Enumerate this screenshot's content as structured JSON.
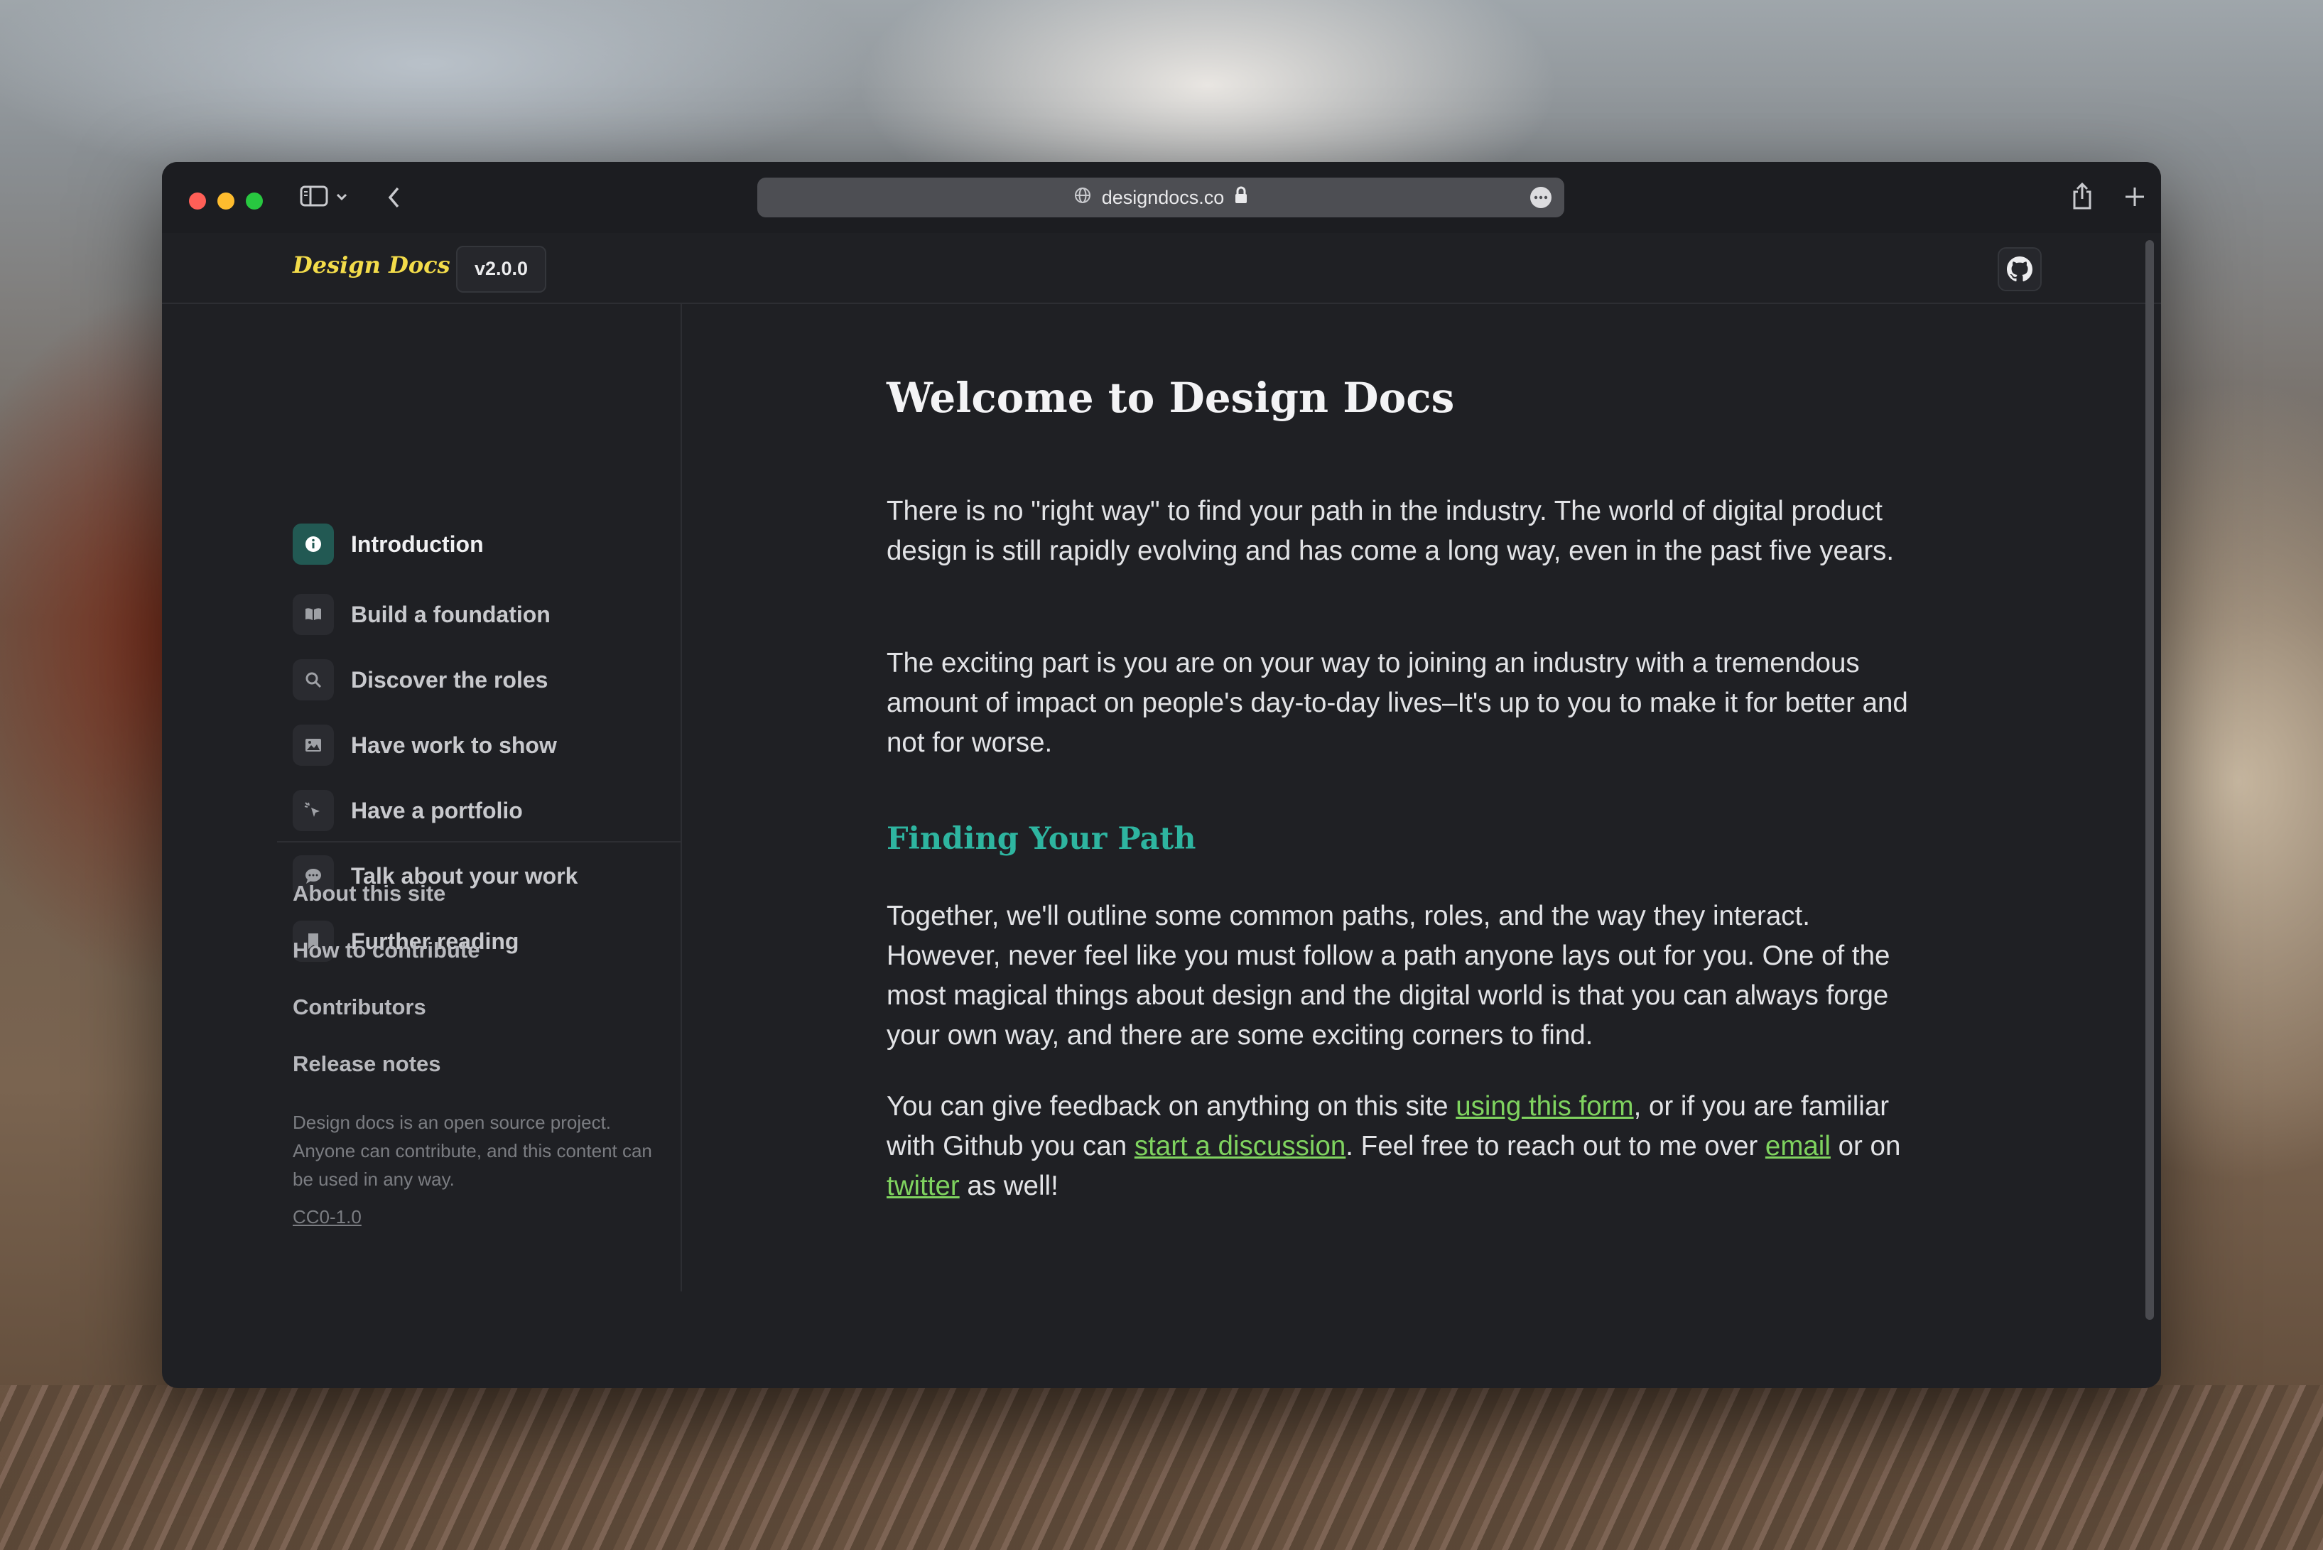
{
  "browser": {
    "url": "designdocs.co"
  },
  "header": {
    "brand": "Design Docs",
    "version": "v2.0.0"
  },
  "sidebar": {
    "items": [
      {
        "label": "Introduction",
        "icon": "info-icon",
        "active": true
      },
      {
        "label": "Build a foundation",
        "icon": "book-icon"
      },
      {
        "label": "Discover the roles",
        "icon": "search-icon"
      },
      {
        "label": "Have work to show",
        "icon": "image-icon"
      },
      {
        "label": "Have a portfolio",
        "icon": "cursor-click-icon"
      },
      {
        "label": "Talk about your work",
        "icon": "chat-bubble-icon"
      },
      {
        "label": "Further reading",
        "icon": "bookmark-icon"
      }
    ],
    "secondary": [
      "About this site",
      "How to contribute",
      "Contributors",
      "Release notes"
    ],
    "note": "Design docs is an open source project. Anyone can contribute, and this content can be used in any way.",
    "license": "CC0-1.0"
  },
  "content": {
    "title": "Welcome to Design Docs",
    "p1": "There is no \"right way\" to find your path in the industry. The world of digital product design is still rapidly evolving and has come a long way, even in the past five years.",
    "p2": "The exciting part is you are on your way to joining an industry with a tremendous amount of impact on people's day-to-day lives–It's up to you to make it for better and not for worse.",
    "h2": "Finding Your Path",
    "p3": "Together, we'll outline some common paths, roles, and the way they interact. However, never feel like you must follow a path anyone lays out for you. One of the most magical things about design and the digital world is that you can always forge your own way, and there are some exciting corners to find.",
    "p4": {
      "t1": "You can give feedback on anything on this site ",
      "link1": "using this form",
      "t2": ", or if you are familiar with Github you can ",
      "link2": "start a discussion",
      "t3": ". Feel free to reach out to me over ",
      "link3": "email",
      "t4": " or on ",
      "link4": "twitter",
      "t5": " as well!"
    }
  },
  "colors": {
    "accent_teal": "#2eb5a0",
    "link_green": "#7fd35f",
    "brand_yellow": "#f3dc4a",
    "background": "#1f2024"
  }
}
